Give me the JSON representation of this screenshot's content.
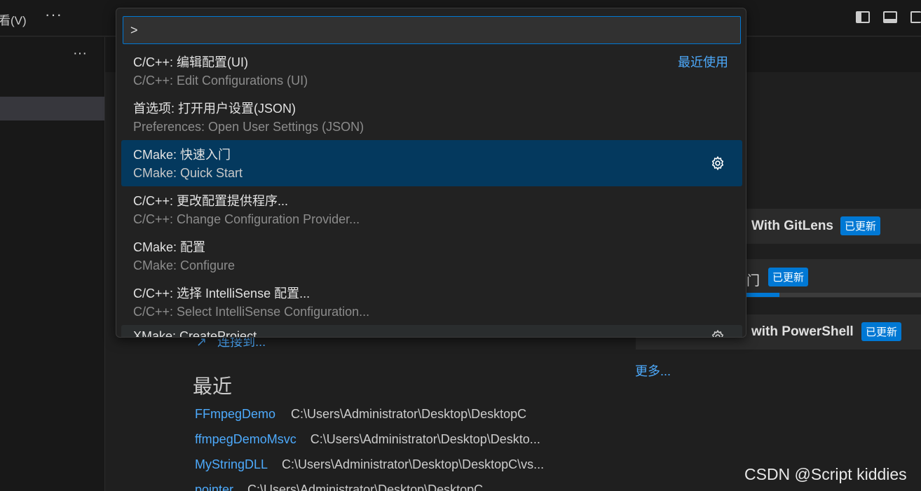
{
  "titlebar": {
    "menu_view": "看(V)",
    "more": "···"
  },
  "sidebar": {
    "more": "···"
  },
  "palette": {
    "input_value": ">",
    "items": [
      {
        "primary": "C/C++: 编辑配置(UI)",
        "secondary": "C/C++: Edit Configurations (UI)",
        "tag": "最近使用"
      },
      {
        "primary": "首选项: 打开用户设置(JSON)",
        "secondary": "Preferences: Open User Settings (JSON)"
      },
      {
        "primary": "CMake: 快速入门",
        "secondary": "CMake: Quick Start"
      },
      {
        "primary": "C/C++: 更改配置提供程序...",
        "secondary": "C/C++: Change Configuration Provider..."
      },
      {
        "primary": "CMake: 配置",
        "secondary": "CMake: Configure"
      },
      {
        "primary": "C/C++: 选择 IntelliSense 配置...",
        "secondary": "C/C++: Select IntelliSense Configuration..."
      },
      {
        "primary": "XMake: CreateProject",
        "secondary": ""
      }
    ]
  },
  "welcome": {
    "connect_label": "连接到...",
    "recent_title": "最近",
    "recent": [
      {
        "name": "FFmpegDemo",
        "path": "C:\\Users\\Administrator\\Desktop\\DesktopC"
      },
      {
        "name": "ffmpegDemoMsvc",
        "path": "C:\\Users\\Administrator\\Desktop\\Deskto..."
      },
      {
        "name": "MyStringDLL",
        "path": "C:\\Users\\Administrator\\Desktop\\DesktopC\\vs..."
      },
      {
        "name": "pointer",
        "path": "C:\\Users\\Administrator\\Desktop\\DesktopC"
      }
    ],
    "walkthroughs": [
      {
        "title": "With GitLens",
        "badge": "已更新"
      },
      {
        "title": "门",
        "badge": "已更新",
        "progress": 0.19
      },
      {
        "title": "with PowerShell",
        "badge": "已更新"
      }
    ],
    "more": "更多..."
  },
  "watermark": "CSDN @Script kiddies",
  "colors": {
    "accent": "#0078d4",
    "link": "#4daafc",
    "selected": "#04395e"
  }
}
